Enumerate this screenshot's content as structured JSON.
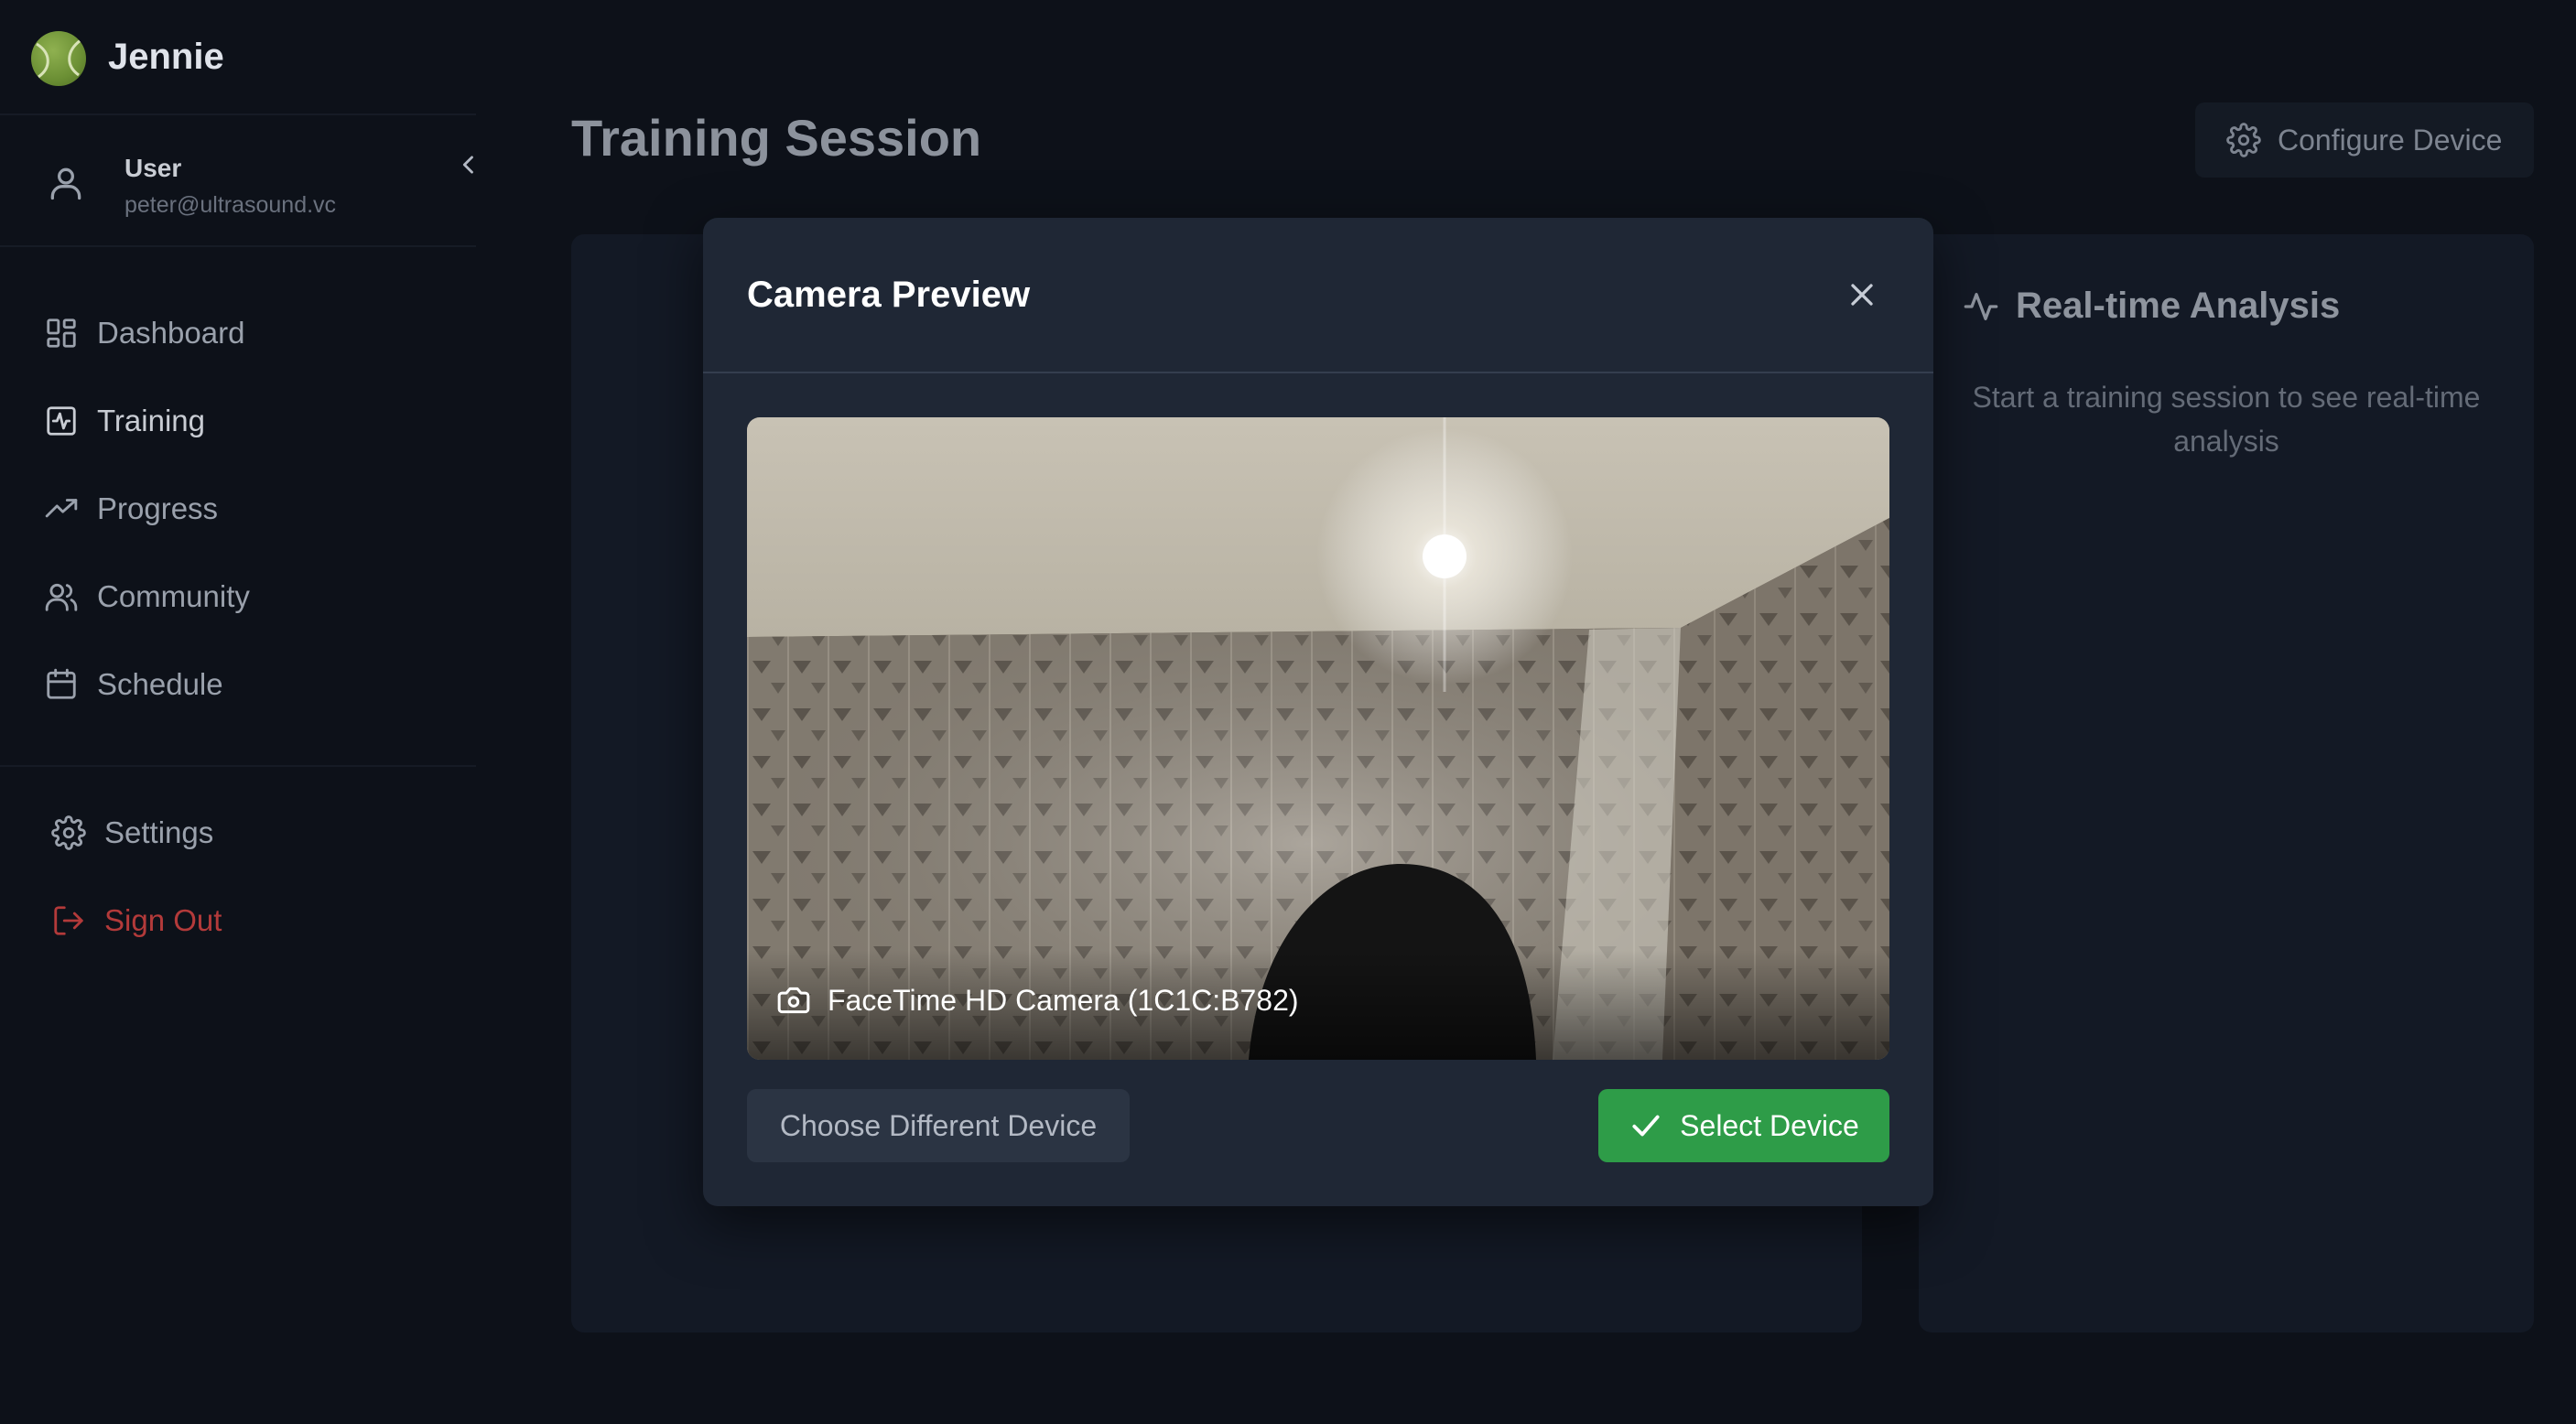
{
  "app": {
    "name": "Jennie",
    "logo_icon": "tennis-ball-logo"
  },
  "user": {
    "name": "User",
    "email": "peter@ultrasound.vc"
  },
  "sidebar": {
    "items": [
      {
        "label": "Dashboard",
        "icon": "layout-grid-icon",
        "active": false
      },
      {
        "label": "Training",
        "icon": "activity-square-icon",
        "active": true
      },
      {
        "label": "Progress",
        "icon": "trending-up-icon",
        "active": false
      },
      {
        "label": "Community",
        "icon": "users-icon",
        "active": false
      },
      {
        "label": "Schedule",
        "icon": "calendar-icon",
        "active": false
      }
    ],
    "settings_label": "Settings",
    "signout_label": "Sign Out"
  },
  "header": {
    "title": "Training Session",
    "configure_label": "Configure Device"
  },
  "analysis": {
    "title": "Real-time Analysis",
    "empty_text": "Start a training session to see real-time analysis"
  },
  "modal": {
    "title": "Camera Preview",
    "camera_name": "FaceTime HD Camera (1C1C:B782)",
    "choose_label": "Choose Different Device",
    "select_label": "Select Device"
  },
  "colors": {
    "background": "#0d1119",
    "panel": "#131925",
    "modal": "#1f2735",
    "primary_green": "#2e9c48",
    "danger_red": "#b33a3a",
    "logo_green": "#6b8f34"
  }
}
